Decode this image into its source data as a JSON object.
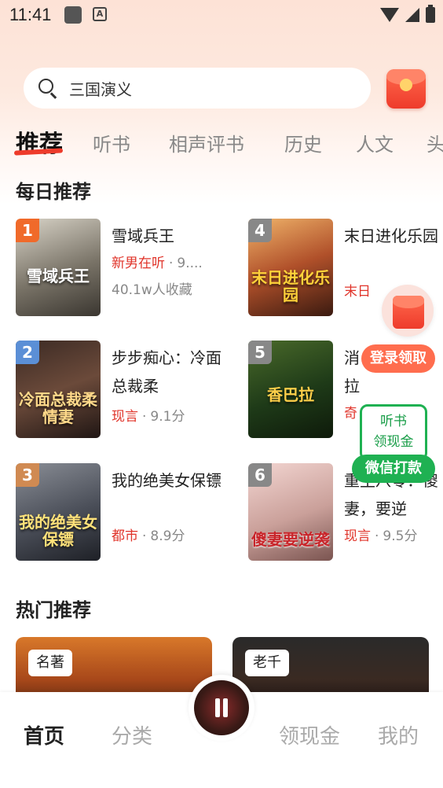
{
  "status_bar": {
    "time": "11:41",
    "notification_icon": "A"
  },
  "search": {
    "placeholder": "三国演义"
  },
  "tabs": [
    {
      "label": "推荐",
      "active": true
    },
    {
      "label": "听书"
    },
    {
      "label": "相声评书"
    },
    {
      "label": "历史"
    },
    {
      "label": "人文"
    },
    {
      "label": "头"
    }
  ],
  "daily": {
    "title": "每日推荐",
    "books": [
      {
        "rank": "1",
        "name": "雪域兵王",
        "category": "新男在听",
        "score": "9....",
        "sub": "40.1w人收藏",
        "cover_text": "雪域兵王",
        "rank_color": "#f06a2a"
      },
      {
        "rank": "2",
        "name": "步步痴心：冷面总裁柔",
        "category": "现言",
        "score": "9.1分",
        "cover_text": "冷面总裁柔情妻",
        "rank_color": "#5b8fd6"
      },
      {
        "rank": "3",
        "name": "我的绝美女保镖",
        "category": "都市",
        "score": "8.9分",
        "cover_text": "我的绝美女保镖",
        "rank_color": "#d08a52"
      },
      {
        "rank": "4",
        "name": "末日进化乐园",
        "category": "末日",
        "score": "",
        "cover_text": "末日进化乐园",
        "rank_color": "#888888"
      },
      {
        "rank": "5",
        "name": "消拉",
        "category": "奇",
        "score": "",
        "cover_text": "香巴拉",
        "rank_color": "#888888"
      },
      {
        "rank": "6",
        "name": "重生八零：傻妻，要逆",
        "category": "现言",
        "score": "9.5分",
        "cover_text": "傻妻要逆袭",
        "rank_color": "#888888"
      }
    ]
  },
  "float": {
    "login_label": "登录领取",
    "wechat_line1": "听书",
    "wechat_line2": "领现金",
    "wechat_btn": "微信打款"
  },
  "hot": {
    "title": "热门推荐",
    "cards": [
      {
        "tag": "名著"
      },
      {
        "tag": "老千"
      }
    ]
  },
  "nav": {
    "home": "首页",
    "category": "分类",
    "cash": "领现金",
    "mine": "我的"
  },
  "colors": {
    "accent": "#ee3b2b",
    "wechat_green": "#1fb152"
  }
}
